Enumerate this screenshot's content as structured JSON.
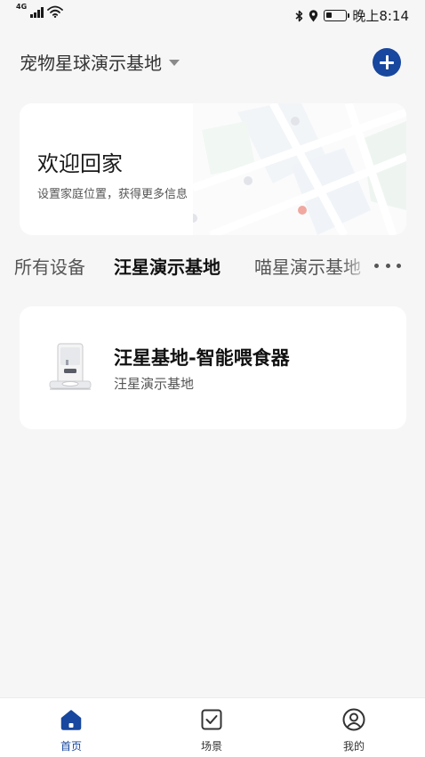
{
  "status_bar": {
    "network_type": "4G",
    "time": "晚上8:14",
    "icons": [
      "signal-icon",
      "wifi-icon",
      "bluetooth-icon",
      "location-icon",
      "battery-icon"
    ],
    "battery_level": 0.3
  },
  "header": {
    "home_name": "宠物星球演示基地",
    "add_icon": "plus-icon"
  },
  "welcome_card": {
    "title": "欢迎回家",
    "subtitle": "设置家庭位置，获得更多信息"
  },
  "tabs": [
    {
      "label": "所有设备",
      "active": false
    },
    {
      "label": "汪星演示基地",
      "active": true
    },
    {
      "label": "喵星演示基地",
      "active": false
    }
  ],
  "devices": [
    {
      "name": "汪星基地-智能喂食器",
      "location": "汪星演示基地",
      "icon": "pet-feeder-image"
    }
  ],
  "bottom_nav": [
    {
      "label": "首页",
      "icon": "home-icon",
      "active": true
    },
    {
      "label": "场景",
      "icon": "scene-checkbox-icon",
      "active": false
    },
    {
      "label": "我的",
      "icon": "profile-icon",
      "active": false
    }
  ],
  "colors": {
    "accent": "#17479e",
    "background": "#f6f6f7",
    "card": "#ffffff",
    "map_dot_red": "#f0a8a0"
  }
}
